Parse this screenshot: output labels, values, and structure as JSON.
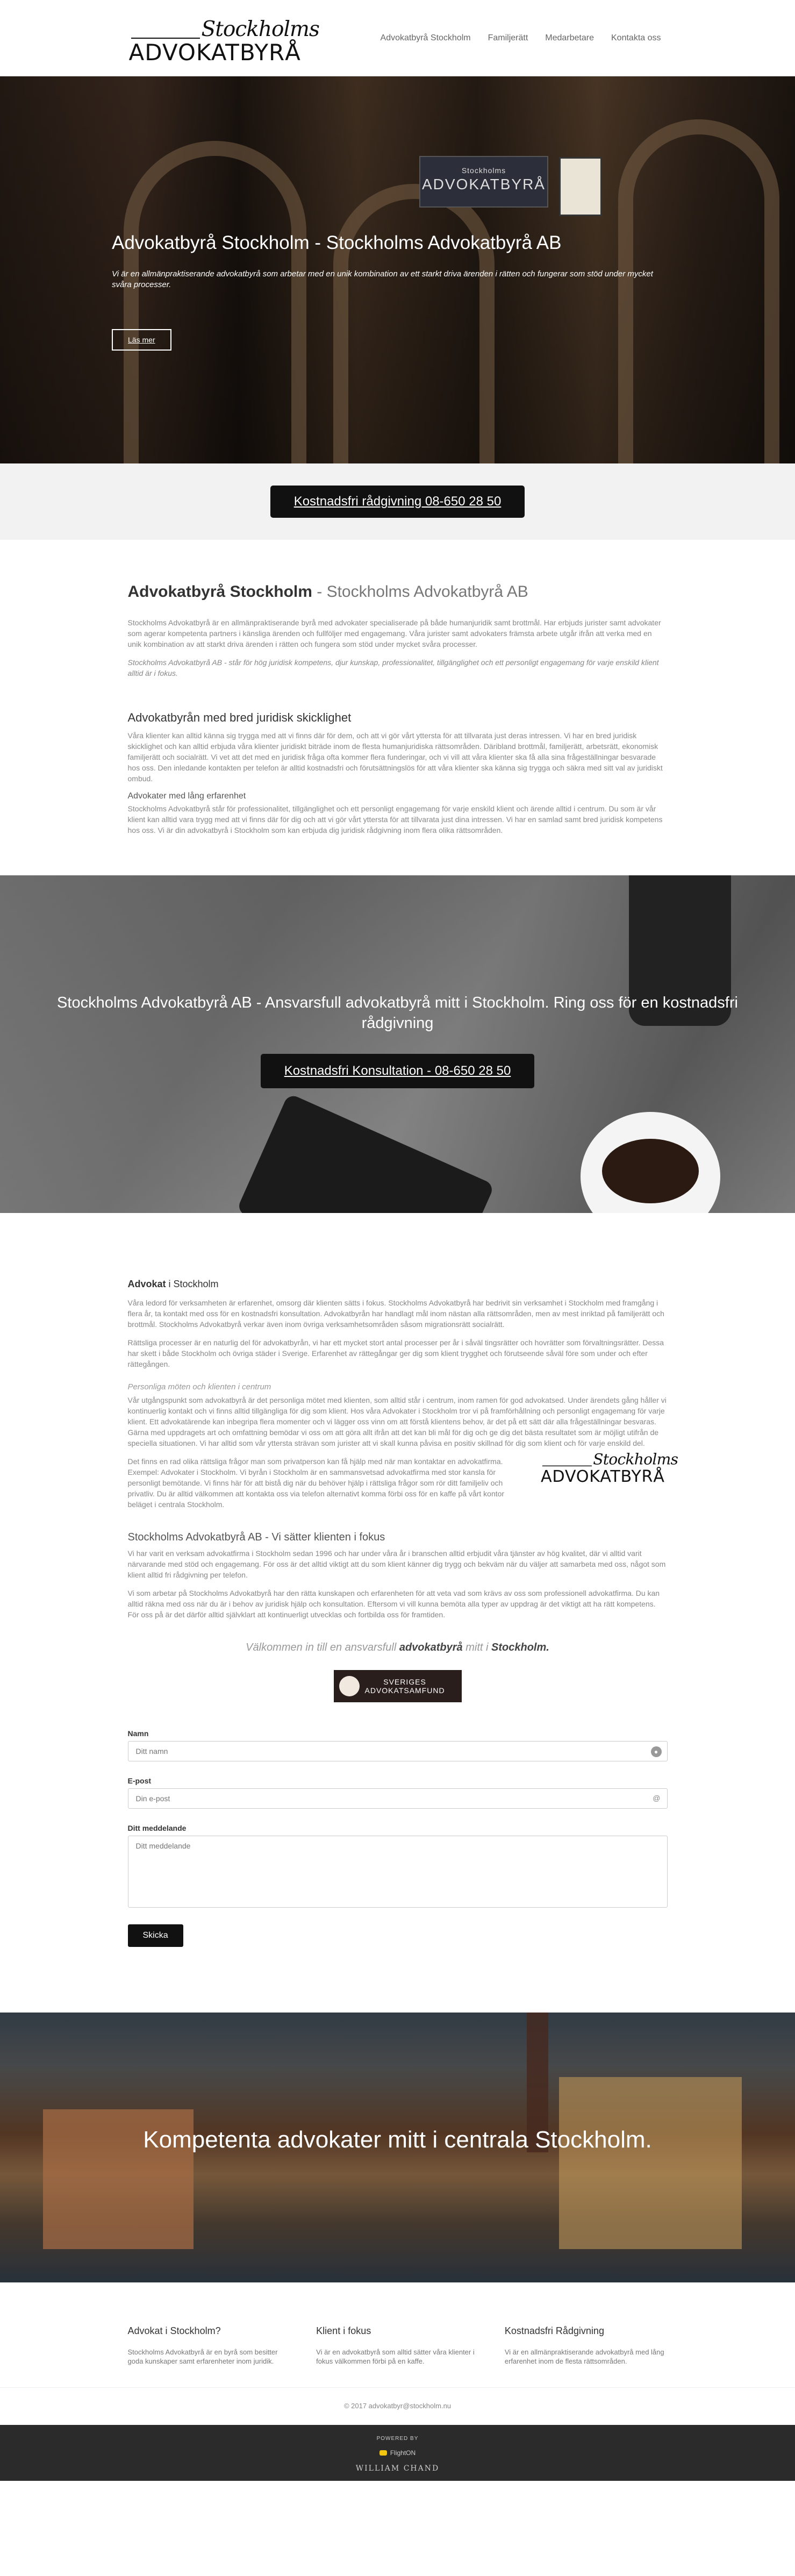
{
  "header": {
    "logo_script": "Stockholms",
    "logo_main": "ADVOKATBYRÅ",
    "nav": [
      "Advokatbyrå Stockholm",
      "Familjerätt",
      "Medarbetare",
      "Kontakta oss"
    ]
  },
  "hero": {
    "sign_main": "ADVOKATBYRÅ",
    "sign_small": "Stockholms",
    "title": "Advokatbyrå Stockholm - Stockholms Advokatbyrå AB",
    "text": "Vi är en allmänpraktiserande advokatbyrå som arbetar med en unik kombination av ett starkt driva ärenden i rätten och fungerar som stöd under mycket svåra processer.",
    "button": "Läs mer"
  },
  "cta_bar": {
    "button": "Kostnadsfri rådgivning 08-650 28 50"
  },
  "intro": {
    "title_bold": "Advokatbyrå Stockholm",
    "title_rest": " - Stockholms Advokatbyrå AB",
    "p1": "Stockholms Advokatbyrå är en allmänpraktiserande byrå med advokater specialiserade på både humanjuridik samt brottmål. Har erbjuds jurister samt advokater som agerar kompetenta partners i känsliga ärenden och fullföljer med engagemang. Våra jurister samt advokaters främsta arbete utgår ifrån att verka med en unik kombination av att starkt driva ärenden i rätten och fungera som stöd under mycket svåra processer.",
    "p2": "Stockholms Advokatbyrå AB - står för hög juridisk kompetens, djur kunskap, professionalitet, tillgänglighet och ett personligt engagemang för varje enskild klient alltid är i fokus.",
    "h3": "Advokatbyrån med bred juridisk skicklighet",
    "p3": "Våra klienter kan alltid känna sig trygga med att vi finns där för dem, och att vi gör vårt yttersta för att tillvarata just deras intressen. Vi har en bred juridisk skicklighet och kan alltid erbjuda våra klienter juridiskt biträde inom de flesta humanjuridiska rättsområden. Däribland brottmål, familjerätt, arbetsrätt, ekonomisk familjerätt och socialrätt. Vi vet att det med en juridisk fråga ofta kommer flera funderingar, och vi vill att våra klienter ska få alla sina frågeställningar besvarade hos oss. Den inledande kontakten per telefon är alltid kostnadsfri och förutsättningslös för att våra klienter ska känna sig trygga och säkra med sitt val av juridiskt ombud.",
    "h4": "Advokater med lång erfarenhet",
    "p4": "Stockholms Advokatbyrå står för professionalitet, tillgänglighet och ett personligt engagemang för varje enskild klient och ärende alltid i centrum. Du som är vår klient kan alltid vara trygg med att vi finns där för dig och att vi gör vårt yttersta för att tillvarata just dina intressen. Vi har en samlad samt bred juridisk kompetens hos oss. Vi är din advokatbyrå i Stockholm som kan erbjuda dig juridisk rådgivning inom flera olika rättsområden."
  },
  "band": {
    "title": "Stockholms Advokatbyrå AB - Ansvarsfull advokatbyrå mitt i Stockholm. Ring oss för en kostnadsfri rådgivning",
    "button": "Kostnadsfri Konsultation - 08-650 28 50"
  },
  "article": {
    "head_bold": "Advokat",
    "head_rest": " i Stockholm",
    "p1": "Våra ledord för verksamheten är erfarenhet, omsorg där klienten sätts i fokus. Stockholms Advokatbyrå har bedrivit sin verksamhet i Stockholm med framgång i flera år, ta kontakt med oss för en kostnadsfri konsultation. Advokatbyrån har handlagt mål inom nästan alla rättsområden, men av mest inriktad på familjerätt och brottmål. Stockholms Advokatbyrå verkar även inom övriga verksamhetsområden såsom migrationsrätt socialrätt.",
    "p2": "Rättsliga processer är en naturlig del för advokatbyrån, vi har ett mycket stort antal processer per år i såväl tingsrätter och hovrätter som förvaltningsrätter. Dessa har skett i både Stockholm och övriga städer i Sverige. Erfarenhet av rättegångar ger dig som klient trygghet och förutseende såväl före som under och efter rättegången.",
    "sub1": "Personliga möten och klienten i centrum",
    "p3": "Vår utgångspunkt som advokatbyrå är det personliga mötet med klienten, som alltid står i centrum, inom ramen för god advokatsed. Under ärendets gång håller vi kontinuerlig kontakt och vi finns alltid tillgängliga för dig som klient. Hos våra Advokater i Stockholm tror vi på framförhållning och personligt engagemang för varje klient. Ett advokatärende kan inbegripa flera momenter och vi lägger oss vinn om att förstå klientens behov, är det på ett sätt där alla frågeställningar besvaras. Gärna med uppdragets art och omfattning bemödar vi oss om att göra allt ifrån att det kan bli mål för dig och ge dig det bästa resultatet som är möjligt utifrån de speciella situationen. Vi har alltid som vår yttersta strävan som jurister att vi skall kunna påvisa en positiv skillnad för dig som klient och för varje enskild del.",
    "p4": "Det finns en rad olika rättsliga frågor man som privatperson kan få hjälp med när man kontaktar en advokatfirma. Exempel: Advokater i Stockholm. Vi byrån i Stockholm är en sammansvetsad advokatfirma med stor kansla för personligt bemötande. Vi finns här för att bistå dig när du behöver hjälp i rättsliga frågor som rör ditt familjeliv och privatliv. Du är alltid välkommen att kontakta oss via telefon alternativt komma förbi oss för en kaffe på vårt kontor beläget i centrala Stockholm.",
    "h3": "Stockholms Advokatbyrå AB - Vi sätter klienten i fokus",
    "p5": "Vi har varit en verksam advokatfirma i Stockholm sedan 1996 och har under våra år i branschen alltid erbjudit våra tjänster av hög kvalitet, där vi alltid varit närvarande med stöd och engagemang. För oss är det alltid viktigt att du som klient känner dig trygg och bekväm när du väljer att samarbeta med oss, något som klient alltid fri rådgivning per telefon.",
    "p6": "Vi som arbetar på Stockholms Advokatbyrå har den rätta kunskapen och erfarenheten för att veta vad som krävs av oss som professionell advokatfirma. Du kan alltid räkna med oss när du är i behov av juridisk hjälp och konsultation. Eftersom vi vill kunna bemöta alla typer av uppdrag är det viktigt att ha rätt kompetens. För oss på är det därför alltid självklart att kontinuerligt utvecklas och fortbilda oss för framtiden.",
    "welcome_pre": "Välkommen in till en ansvarsfull ",
    "welcome_bold1": "advokatbyrå",
    "welcome_mid": " mitt i ",
    "welcome_bold2": "Stockholm.",
    "badge_line1": "SVERIGES",
    "badge_line2": "ADVOKATSAMFUND"
  },
  "form": {
    "name_label": "Namn",
    "name_placeholder": "Ditt namn",
    "email_label": "E-post",
    "email_placeholder": "Din e-post",
    "message_label": "Ditt meddelande",
    "message_placeholder": "Ditt meddelande",
    "submit": "Skicka"
  },
  "city": {
    "title": "Kompetenta advokater mitt i centrala Stockholm."
  },
  "footer": {
    "cols": [
      {
        "title": "Advokat i Stockholm?",
        "text": "Stockholms Advokatbyrå är en byrå som besitter goda kunskaper samt erfarenheter inom juridik."
      },
      {
        "title": "Klient i fokus",
        "text": "Vi är en advokatbyrå som alltid sätter våra klienter i fokus välkommen förbi på en kaffe."
      },
      {
        "title": "Kostnadsfri Rådgivning",
        "text": "Vi är en allmänpraktiserande advokatbyrå med lång erfarenhet inom de flesta rättsområden."
      }
    ],
    "copyright": "© 2017 advokatbyr@stockholm.nu",
    "powered": "POWERED BY",
    "flight": "FlightON",
    "william": "WILLIAM CHAND"
  }
}
